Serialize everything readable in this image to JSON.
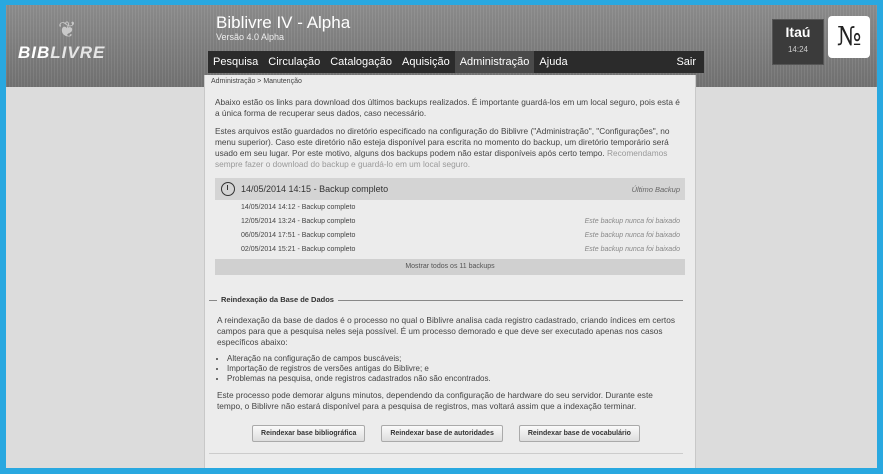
{
  "header": {
    "logo_icon": "book-icon",
    "logo_text_a": "BIB",
    "logo_text_b": "LIVRE",
    "title": "Biblivre IV - Alpha",
    "version": "Versão 4.0 Alpha",
    "bank_name": "Itaú",
    "time": "14:24",
    "bank_logo_icon": "bank-monogram-icon"
  },
  "menu": {
    "items": [
      "Pesquisa",
      "Circulação",
      "Catalogação",
      "Aquisição",
      "Administração",
      "Ajuda"
    ],
    "active": "Administração",
    "logout": "Sair"
  },
  "breadcrumb": "Administração > Manutenção",
  "backup": {
    "para1": "Abaixo estão os links para download dos últimos backups realizados. É importante guardá-los em um local seguro, pois esta é a única forma de recuperar seus dados, caso necessário.",
    "para2_a": "Estes arquivos estão guardados no diretório especificado na configuração do Biblivre (\"Administração\", \"Configurações\", no menu superior). Caso este diretório não esteja disponível para escrita no momento do backup, um diretório temporário será usado em seu lugar. Por este motivo, alguns dos backups podem não estar disponíveis após certo tempo.",
    "para2_b": " Recomendamos sempre fazer o download do backup e guardá-lo em um local seguro.",
    "latest_label": "14/05/2014 14:15 - Backup completo",
    "latest_tag": "Último Backup",
    "rows": [
      {
        "date": "14/05/2014 14:12 - Backup completo",
        "note": ""
      },
      {
        "date": "12/05/2014 13:24 - Backup completo",
        "note": "Este backup nunca foi baixado"
      },
      {
        "date": "06/05/2014 17:51 - Backup completo",
        "note": "Este backup nunca foi baixado"
      },
      {
        "date": "02/05/2014 15:21 - Backup completo",
        "note": "Este backup nunca foi baixado"
      }
    ],
    "show_all": "Mostrar todos os 11 backups"
  },
  "reindex": {
    "legend": "Reindexação da Base de Dados",
    "para1": "A reindexação da base de dados é o processo no qual o Biblivre analisa cada registro cadastrado, criando índices em certos campos para que a pesquisa neles seja possível. É um processo demorado e que deve ser executado apenas nos casos específicos abaixo:",
    "bullets": [
      "Alteração na configuração de campos buscáveis;",
      "Importação de registros de versões antigas do Biblivre; e",
      "Problemas na pesquisa, onde registros cadastrados não são encontrados."
    ],
    "para2": "Este processo pode demorar alguns minutos, dependendo da configuração de hardware do seu servidor. Durante este tempo, o Biblivre não estará disponível para a pesquisa de registros, mas voltará assim que a indexação terminar.",
    "buttons": [
      "Reindexar base bibliográfica",
      "Reindexar base de autoridades",
      "Reindexar base de vocabulário"
    ]
  }
}
